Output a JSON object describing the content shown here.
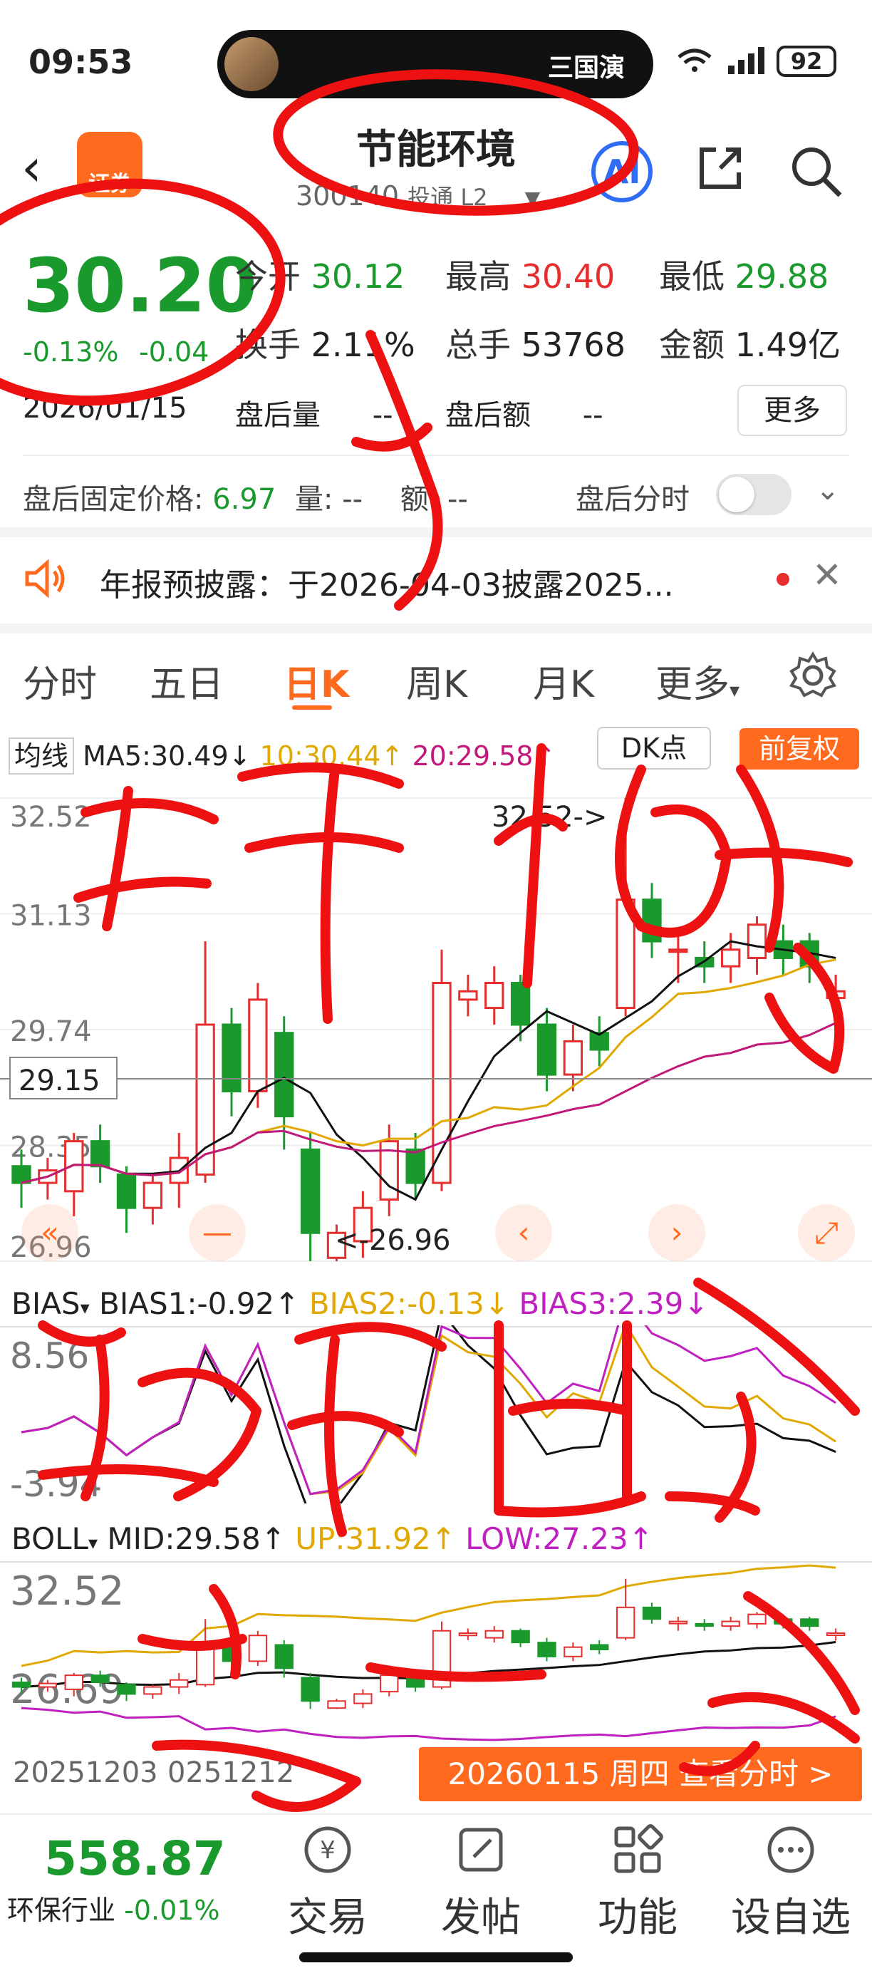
{
  "status": {
    "time": "09:53",
    "island_text": "三国演",
    "battery": "92"
  },
  "header": {
    "title": "节能环境",
    "code": "300140",
    "code_tags": "投通 L2",
    "broker_logo": "证券",
    "ai_label": "AI"
  },
  "quote": {
    "price": "30.20",
    "change_pct": "-0.13%",
    "change_amt": "-0.04",
    "open_label": "今开",
    "open": "30.12",
    "high_label": "最高",
    "high": "30.40",
    "low_label": "最低",
    "low": "29.88",
    "turnover_label": "换手",
    "turnover": "2.11%",
    "volume_label": "总手",
    "volume": "53768",
    "amount_label": "金额",
    "amount": "1.49亿",
    "date": "2026/01/15",
    "ah_vol_label": "盘后量",
    "ah_vol": "--",
    "ah_amt_label": "盘后额",
    "ah_amt": "--",
    "more_label": "更多",
    "fixed_price_label": "盘后固定价格:",
    "fixed_price": "6.97",
    "fixed_vol_label": "量:",
    "fixed_vol": "--",
    "fixed_amt_label": "额:",
    "fixed_amt": "--",
    "ah_timeshare_label": "盘后分时"
  },
  "notice": {
    "text": "年报预披露：于2026-04-03披露2025..."
  },
  "tabs": [
    "分时",
    "五日",
    "日K",
    "周K",
    "月K",
    "更多"
  ],
  "indicators": {
    "ma_label": "均线",
    "ma5": "MA5:30.49↓",
    "ma10": "10:30.44↑",
    "ma20": "20:29.58↑",
    "dk_label": "DK点",
    "fq_label": "前复权",
    "bias_label": "BIAS",
    "bias1": "BIAS1:-0.92↑",
    "bias2": "BIAS2:-0.13↓",
    "bias3": "BIAS3:2.39↓",
    "boll_label": "BOLL",
    "mid": "MID:29.58↑",
    "up": "UP:31.92↑",
    "low": "LOW:27.23↑"
  },
  "chart_data": [
    {
      "type": "candlestick",
      "y_ticks": [
        "32.52",
        "31.13",
        "29.74",
        "28.35",
        "26.96"
      ],
      "crosshair_label": "29.15",
      "annotations": [
        "32.52->",
        "<-26.96"
      ],
      "ylim": [
        26.96,
        32.52
      ],
      "candles": [
        {
          "o": 28.1,
          "c": 27.9,
          "h": 28.3,
          "l": 27.6
        },
        {
          "o": 27.9,
          "c": 28.05,
          "h": 28.2,
          "l": 27.7
        },
        {
          "o": 27.8,
          "c": 28.4,
          "h": 28.5,
          "l": 27.5
        },
        {
          "o": 28.4,
          "c": 28.1,
          "h": 28.6,
          "l": 27.9
        },
        {
          "o": 28.0,
          "c": 27.6,
          "h": 28.1,
          "l": 27.3
        },
        {
          "o": 27.6,
          "c": 27.9,
          "h": 28.0,
          "l": 27.4
        },
        {
          "o": 27.9,
          "c": 28.2,
          "h": 28.5,
          "l": 27.6
        },
        {
          "o": 28.0,
          "c": 29.8,
          "h": 30.8,
          "l": 27.9
        },
        {
          "o": 29.8,
          "c": 29.0,
          "h": 30.0,
          "l": 28.7
        },
        {
          "o": 29.0,
          "c": 30.1,
          "h": 30.3,
          "l": 28.8
        },
        {
          "o": 29.7,
          "c": 28.7,
          "h": 29.9,
          "l": 28.3
        },
        {
          "o": 28.3,
          "c": 27.3,
          "h": 28.5,
          "l": 26.96
        },
        {
          "o": 27.0,
          "c": 27.3,
          "h": 27.4,
          "l": 26.96
        },
        {
          "o": 27.2,
          "c": 27.6,
          "h": 27.8,
          "l": 27.0
        },
        {
          "o": 27.7,
          "c": 28.4,
          "h": 28.6,
          "l": 27.5
        },
        {
          "o": 28.3,
          "c": 27.9,
          "h": 28.5,
          "l": 27.7
        },
        {
          "o": 27.9,
          "c": 30.3,
          "h": 30.7,
          "l": 27.8
        },
        {
          "o": 30.1,
          "c": 30.2,
          "h": 30.4,
          "l": 29.9
        },
        {
          "o": 30.0,
          "c": 30.3,
          "h": 30.5,
          "l": 29.8
        },
        {
          "o": 30.3,
          "c": 29.8,
          "h": 30.4,
          "l": 29.6
        },
        {
          "o": 29.8,
          "c": 29.2,
          "h": 30.0,
          "l": 29.0
        },
        {
          "o": 29.2,
          "c": 29.6,
          "h": 29.8,
          "l": 29.0
        },
        {
          "o": 29.7,
          "c": 29.5,
          "h": 29.9,
          "l": 29.3
        },
        {
          "o": 30.0,
          "c": 31.3,
          "h": 32.52,
          "l": 29.9
        },
        {
          "o": 31.3,
          "c": 30.8,
          "h": 31.5,
          "l": 30.6
        },
        {
          "o": 30.7,
          "c": 30.7,
          "h": 30.9,
          "l": 30.3
        },
        {
          "o": 30.6,
          "c": 30.5,
          "h": 30.8,
          "l": 30.3
        },
        {
          "o": 30.5,
          "c": 30.7,
          "h": 30.9,
          "l": 30.3
        },
        {
          "o": 30.6,
          "c": 31.0,
          "h": 31.1,
          "l": 30.4
        },
        {
          "o": 30.8,
          "c": 30.6,
          "h": 31.0,
          "l": 30.4
        },
        {
          "o": 30.8,
          "c": 30.5,
          "h": 30.9,
          "l": 30.3
        },
        {
          "o": 30.12,
          "c": 30.2,
          "h": 30.4,
          "l": 29.88
        }
      ]
    },
    {
      "type": "line",
      "name": "BIAS",
      "y_ticks": [
        "8.56",
        "-3.94"
      ]
    },
    {
      "type": "line",
      "name": "BOLL",
      "y_ticks": [
        "32.52",
        "26.69"
      ]
    }
  ],
  "dates": {
    "start": "20251203",
    "mid": "0251212"
  },
  "view_timeshare": "20260115 周四 查看分时 >",
  "bottom": {
    "index_value": "558.87",
    "index_name": "环保行业",
    "index_change": "-0.01%",
    "trade": "交易",
    "post": "发帖",
    "functions": "功能",
    "watchlist": "设自选"
  },
  "colors": {
    "accent": "#ff6a1f",
    "up": "#e62e2e",
    "down": "#1a9a2c",
    "ink": "#ee1111"
  }
}
